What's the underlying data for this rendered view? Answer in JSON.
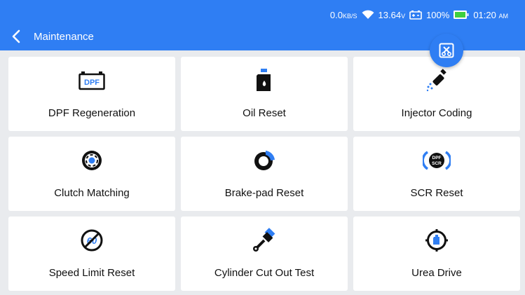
{
  "status_bar": {
    "net_speed": "0.0",
    "net_unit": "KB/S",
    "voltage": "13.64",
    "voltage_unit": "V",
    "battery": "100%",
    "time": "01:20",
    "ampm": "AM",
    "wifi_icon": "wifi-icon",
    "car_battery_icon": "car-battery-icon",
    "battery_icon": "battery-icon"
  },
  "header": {
    "title": "Maintenance",
    "back_icon": "chevron-left-icon"
  },
  "fab": {
    "icon": "screenshot-tool-icon"
  },
  "tiles": [
    {
      "label": "DPF Regeneration",
      "icon": "dpf-icon",
      "icon_text": "DPF"
    },
    {
      "label": "Oil Reset",
      "icon": "oil-can-icon"
    },
    {
      "label": "Injector Coding",
      "icon": "injector-icon"
    },
    {
      "label": "Clutch Matching",
      "icon": "clutch-icon"
    },
    {
      "label": "Brake-pad Reset",
      "icon": "brake-pad-icon"
    },
    {
      "label": "SCR Reset",
      "icon": "scr-icon",
      "icon_text_1": "DPF",
      "icon_text_2": "SCR"
    },
    {
      "label": "Speed Limit Reset",
      "icon": "speed-limit-icon",
      "icon_text": "60"
    },
    {
      "label": "Cylinder Cut Out Test",
      "icon": "piston-icon"
    },
    {
      "label": "Urea Drive",
      "icon": "urea-drive-icon"
    }
  ],
  "colors": {
    "accent": "#2f7ef3",
    "icon_dark": "#111111",
    "background": "#e9ebee",
    "tile": "#ffffff"
  }
}
